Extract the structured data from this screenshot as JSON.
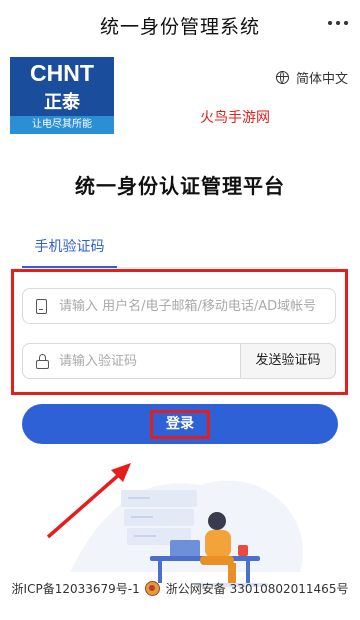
{
  "topbar": {
    "title": "统一身份管理系统"
  },
  "logo": {
    "brand": "CHNT",
    "cn": "正泰",
    "slogan": "让电尽其所能"
  },
  "language": {
    "label": "简体中文"
  },
  "watermark": "火鸟手游网",
  "heading": "统一身份认证管理平台",
  "tabs": [
    {
      "label": "手机验证码",
      "active": true
    }
  ],
  "form": {
    "account_placeholder": "请输入 用户名/电子邮箱/移动电话/AD域帐号",
    "code_placeholder": "请输入验证码",
    "send_code_label": "发送验证码"
  },
  "login": {
    "label": "登录"
  },
  "footer": {
    "icp": "浙ICP备12033679号-1",
    "police": "浙公网安备 33010802011465号"
  },
  "colors": {
    "primary": "#2f61d6",
    "annotation": "#e41d1d",
    "logo_bg": "#1b4d9d"
  }
}
